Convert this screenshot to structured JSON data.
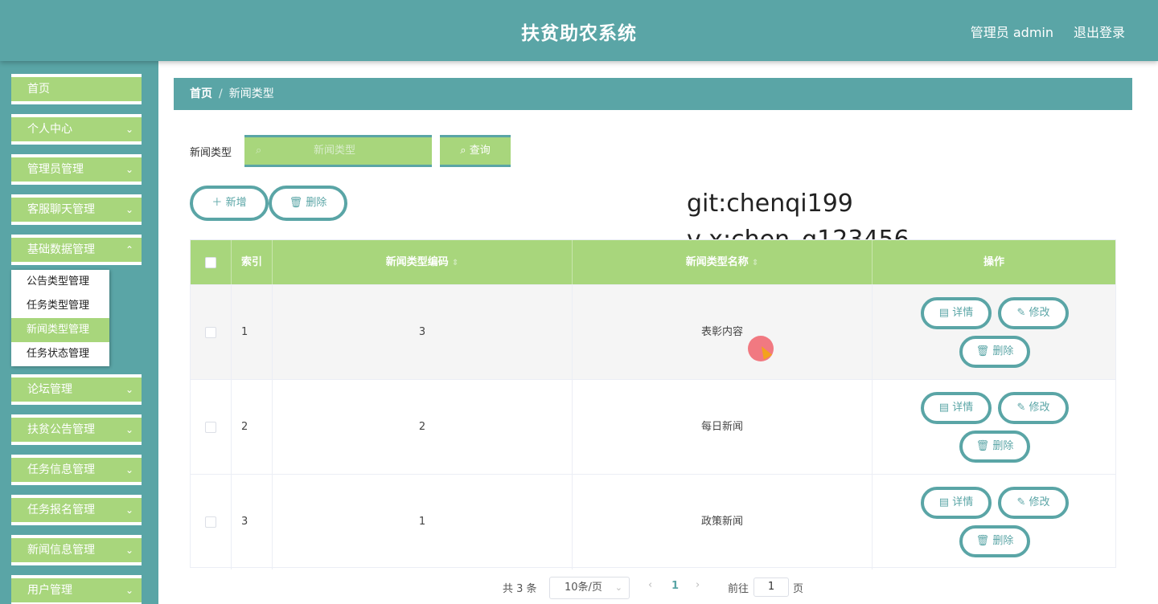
{
  "header": {
    "title": "扶贫助农系统",
    "user": "管理员 admin",
    "logout": "退出登录"
  },
  "sidebar": {
    "items": [
      {
        "label": "首页",
        "chevron": ""
      },
      {
        "label": "个人中心",
        "chevron": "⌄"
      },
      {
        "label": "管理员管理",
        "chevron": "⌄"
      },
      {
        "label": "客服聊天管理",
        "chevron": "⌄"
      },
      {
        "label": "基础数据管理",
        "chevron": "⌃"
      },
      {
        "label": "论坛管理",
        "chevron": "⌄"
      },
      {
        "label": "扶贫公告管理",
        "chevron": "⌄"
      },
      {
        "label": "任务信息管理",
        "chevron": "⌄"
      },
      {
        "label": "任务报名管理",
        "chevron": "⌄"
      },
      {
        "label": "新闻信息管理",
        "chevron": "⌄"
      },
      {
        "label": "用户管理",
        "chevron": "⌄"
      }
    ],
    "submenu": [
      "公告类型管理",
      "任务类型管理",
      "新闻类型管理",
      "任务状态管理"
    ]
  },
  "breadcrumb": {
    "home": "首页",
    "sep": "/",
    "current": "新闻类型"
  },
  "search": {
    "label": "新闻类型",
    "placeholder": "新闻类型",
    "query": "查询"
  },
  "toolbar": {
    "add": "新增",
    "delete": "删除"
  },
  "watermark": {
    "line1": "git:chenqi199",
    "line2": "v x:chen_q123456"
  },
  "table": {
    "headers": {
      "index": "索引",
      "code": "新闻类型编码",
      "name": "新闻类型名称",
      "actions": "操作"
    },
    "rows": [
      {
        "index": "1",
        "code": "3",
        "name": "表彰内容"
      },
      {
        "index": "2",
        "code": "2",
        "name": "每日新闻"
      },
      {
        "index": "3",
        "code": "1",
        "name": "政策新闻"
      }
    ],
    "actions": {
      "detail": "详情",
      "edit": "修改",
      "delete": "删除"
    }
  },
  "pagination": {
    "total": "共 3 条",
    "page_size": "10条/页",
    "current": "1",
    "goto": "前往",
    "goto_value": "1",
    "page_unit": "页"
  },
  "icons": {
    "search": "search-icon",
    "plus": "plus-icon",
    "trash": "trash-icon",
    "doc": "document-icon",
    "pen": "edit-icon"
  },
  "colors": {
    "primary": "#5aa5a6",
    "accent": "#a8d67c"
  }
}
